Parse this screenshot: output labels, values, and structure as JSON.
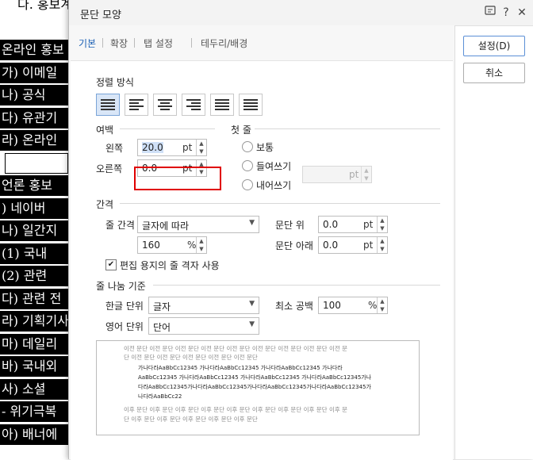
{
  "document": {
    "top_text": "다. 홍보계획",
    "lines": [
      "온라인 홍보",
      "가) 이메일",
      "나) 공식 ",
      "다) 유관기",
      "라) 온라인",
      "",
      "언론 홍보",
      ") 네이버 ",
      "나) 일간지",
      "(1) 국내 ",
      "(2) 관련 ",
      "다) 관련 전",
      "라) 기획기사",
      "마) 데일리",
      "바) 국내외",
      "사) 소셜 ",
      "- 위기극복",
      "아) 배너에 "
    ]
  },
  "dialog": {
    "title": "문단 모양",
    "help_icon": "help-icon",
    "tabs": [
      "기본",
      "확장",
      "탭 설정",
      "테두리/배경"
    ],
    "alignment": {
      "label": "정렬 방식",
      "options": [
        "justify",
        "left",
        "center",
        "right",
        "distribute",
        "divide"
      ],
      "selected": "justify"
    },
    "margin": {
      "label": "여백",
      "left_label": "왼쪽",
      "left_value": "20.0",
      "right_label": "오른쪽",
      "right_value": "0.0",
      "unit": "pt"
    },
    "first_line": {
      "label": "첫 줄",
      "options": [
        "보통",
        "들여쓰기",
        "내어쓰기"
      ],
      "indent_unit": "pt"
    },
    "spacing": {
      "label": "간격",
      "line_spacing_label": "줄 간격",
      "line_spacing_type": "글자에 따라",
      "line_spacing_value": "160",
      "line_spacing_unit": "%",
      "above_label": "문단 위",
      "above_value": "0.0",
      "below_label": "문단 아래",
      "below_value": "0.0",
      "unit": "pt",
      "grid_checkbox_label": "편집 용지의 줄 격자 사용"
    },
    "line_break": {
      "label": "줄 나눔 기준",
      "korean_label": "한글 단위",
      "korean_value": "글자",
      "english_label": "영어 단위",
      "english_value": "단어",
      "min_space_label": "최소 공백",
      "min_space_value": "100",
      "min_space_unit": "%"
    },
    "preview": {
      "prev_line1": "이전 문단 이전 문단 이전 문단 이전 문단 이전 문단 이전 문단 이전 문단 이전 문단 이전 문",
      "prev_line2": "단 이전 문단 이전 문단 이전 문단 이전 문단 이전 문단",
      "cur_line1": "가나다라AaBbCc12345    가나다라AaBbCc12345    가나다라AaBbCc12345    가나다라",
      "cur_line2": "AaBbCc12345    가나다라AaBbCc12345    가나다라AaBbCc12345    가나다라AaBbCc12345가나",
      "cur_line3": "다라AaBbCc12345가나다라AaBbCc12345가나다라AaBbCc12345가나다라AaBbCc12345가",
      "cur_line4": "나다라AaBbCc22",
      "next_line1": "이후 문단 이후 문단 이후 문단 이후 문단 이후 문단 이후 문단 이후 문단 이후 문단 이후 문",
      "next_line2": "단 이후 문단 이후 문단 이후 문단 이후 문단 이후 문단"
    },
    "buttons": {
      "ok": "설정(D)",
      "cancel": "취소"
    }
  }
}
